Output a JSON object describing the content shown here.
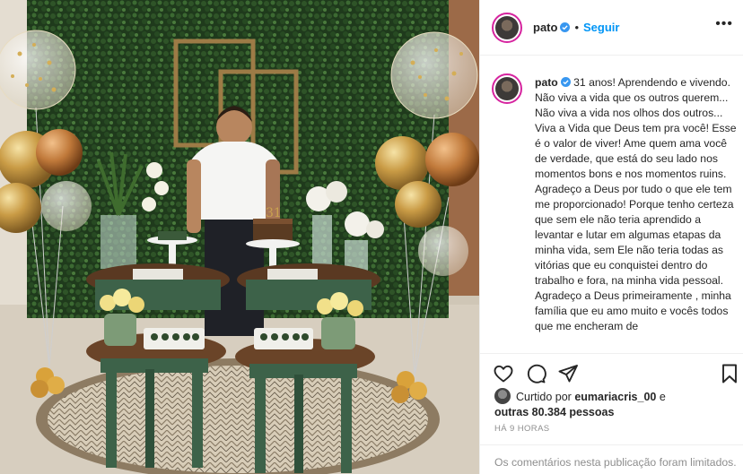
{
  "post": {
    "username": "pato",
    "follow_label": "Seguir",
    "separator": "•",
    "more_label": "•••",
    "caption_username": "pato",
    "caption": "31 anos! Aprendendo e vivendo. Não viva a vida que os outros querem... Não viva a vida nos olhos dos outros... Viva a Vida que Deus tem pra você! Esse é o valor de viver! Ame quem ama você de verdade, que está do seu lado nos momentos bons e nos momentos ruins. Agradeço a Deus por tudo o que ele tem me proporcionado! Porque tenho certeza que sem ele não teria aprendido a levantar e lutar em algumas etapas da minha vida, sem Ele não teria todas as vitórias que eu conquistei dentro do trabalho e fora, na minha vida pessoal. Agradeço a Deus primeiramente , minha família que eu amo muito e vocês todos que me encheram de",
    "likes_prefix": "Curtido por ",
    "liked_by": "eumariacris_00",
    "likes_middle": " e",
    "likes_others": "outras 80.384 pessoas",
    "time_ago": "HÁ 9 HORAS",
    "comments_limited": "Os comentários nesta publicação foram limitados."
  },
  "icons": {
    "verified": "verified-badge-icon",
    "like": "heart-icon",
    "comment": "comment-icon",
    "share": "paper-plane-icon",
    "save": "bookmark-icon"
  },
  "colors": {
    "link_blue": "#0095f6",
    "verified_blue": "#3897f0",
    "muted_gray": "#8e8e8e",
    "border": "#efefef"
  }
}
